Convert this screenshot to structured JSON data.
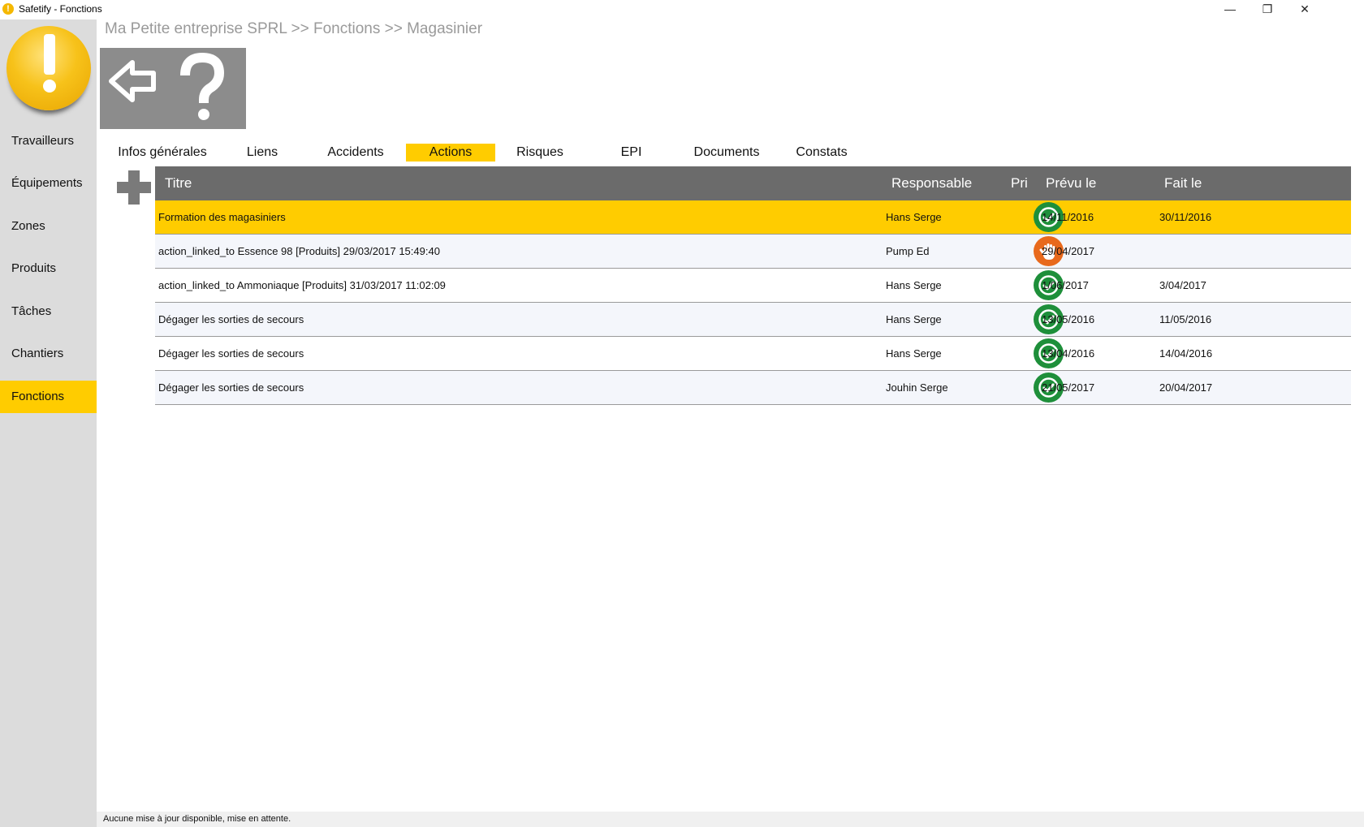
{
  "window": {
    "title": "Safetify - Fonctions",
    "icon": "safetify-icon",
    "controls": {
      "minimize": "—",
      "restore": "❐",
      "close": "✕"
    }
  },
  "breadcrumb": "Ma Petite entreprise SPRL >> Fonctions >> Magasinier",
  "sidebar": {
    "items": [
      {
        "label": "Travailleurs"
      },
      {
        "label": "Équipements"
      },
      {
        "label": "Zones"
      },
      {
        "label": "Produits"
      },
      {
        "label": "Tâches"
      },
      {
        "label": "Chantiers"
      },
      {
        "label": "Fonctions",
        "active": true
      }
    ]
  },
  "toolbar": {
    "back_icon": "back-arrow-icon",
    "help_icon": "help-question-icon"
  },
  "tabs": [
    {
      "label": "Infos générales"
    },
    {
      "label": "Liens"
    },
    {
      "label": "Accidents"
    },
    {
      "label": "Actions",
      "active": true
    },
    {
      "label": "Risques"
    },
    {
      "label": "EPI"
    },
    {
      "label": "Documents"
    },
    {
      "label": "Constats"
    }
  ],
  "table": {
    "headers": {
      "titre": "Titre",
      "responsable": "Responsable",
      "pri": "Pri",
      "prevu": "Prévu le",
      "fait": "Fait le"
    },
    "rows": [
      {
        "titre": "Formation des magasiniers",
        "responsable": "Hans Serge",
        "status": "done",
        "prevu": "14/11/2016",
        "fait": "30/11/2016"
      },
      {
        "titre": "action_linked_to Essence 98 [Produits]  29/03/2017 15:49:40",
        "responsable": "Pump Ed",
        "status": "stop",
        "prevu": "29/04/2017",
        "fait": ""
      },
      {
        "titre": "action_linked_to Ammoniaque [Produits]  31/03/2017 11:02:09",
        "responsable": "Hans Serge",
        "status": "done",
        "prevu": "1/06/2017",
        "fait": "3/04/2017"
      },
      {
        "titre": "Dégager les sorties de secours",
        "responsable": "Hans Serge",
        "status": "done",
        "prevu": "13/05/2016",
        "fait": "11/05/2016"
      },
      {
        "titre": "Dégager les sorties de secours",
        "responsable": "Hans Serge",
        "status": "done",
        "prevu": "13/04/2016",
        "fait": "14/04/2016"
      },
      {
        "titre": "Dégager les sorties de secours",
        "responsable": "Jouhin Serge",
        "status": "done",
        "prevu": "21/05/2017",
        "fait": "20/04/2017"
      }
    ]
  },
  "status_bar": "Aucune mise à jour disponible, mise en attente.",
  "colors": {
    "accent": "#ffcc00",
    "header": "#6b6b6b",
    "sidebar": "#dcdcdc",
    "ok": "#1e8f3a",
    "stop": "#e8691c"
  }
}
